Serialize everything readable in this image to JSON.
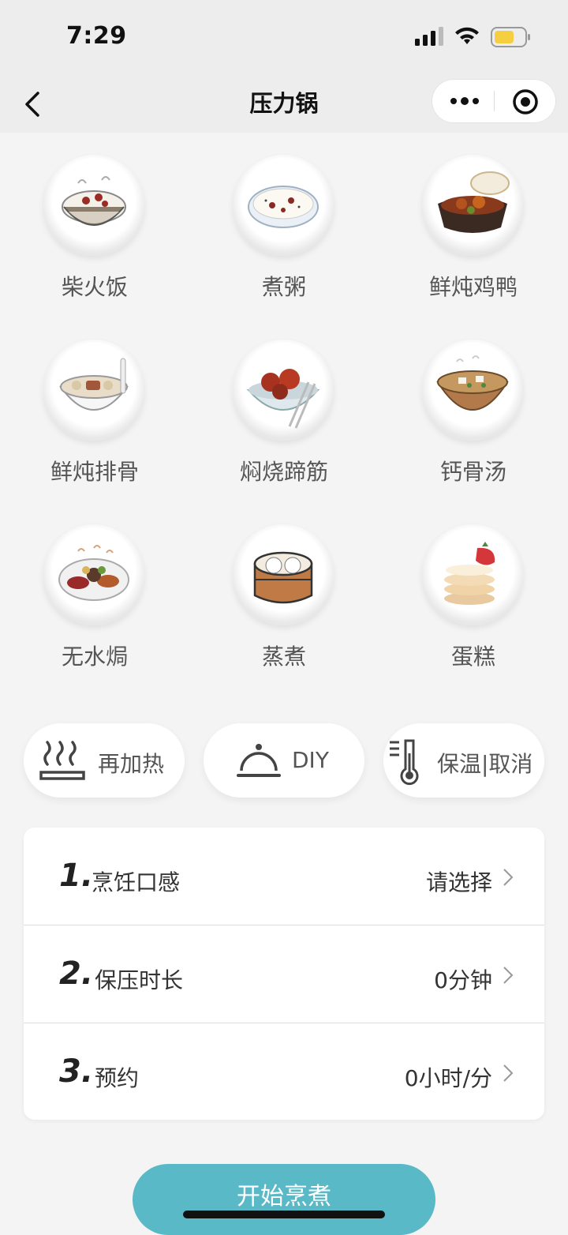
{
  "status": {
    "time": "7:29"
  },
  "nav": {
    "title": "压力锅"
  },
  "recipes": [
    {
      "label": "柴火饭",
      "icon": "rice-bowl-icon"
    },
    {
      "label": "煮粥",
      "icon": "porridge-icon"
    },
    {
      "label": "鲜炖鸡鸭",
      "icon": "clay-pot-chicken-icon"
    },
    {
      "label": "鲜炖排骨",
      "icon": "rib-soup-icon"
    },
    {
      "label": "焖烧蹄筋",
      "icon": "braised-tendon-icon"
    },
    {
      "label": "钙骨汤",
      "icon": "bone-soup-icon"
    },
    {
      "label": "无水焗",
      "icon": "waterless-bake-icon"
    },
    {
      "label": "蒸煮",
      "icon": "steamer-icon"
    },
    {
      "label": "蛋糕",
      "icon": "cake-icon"
    }
  ],
  "quick": {
    "reheat": "再加热",
    "diy": "DIY",
    "keep_warm": "保温|取消"
  },
  "settings": [
    {
      "num": "1.",
      "label": "烹饪口感",
      "value": "请选择"
    },
    {
      "num": "2.",
      "label": "保压时长",
      "value": "0分钟"
    },
    {
      "num": "3.",
      "label": "预约",
      "value": "0小时/分"
    }
  ],
  "start_button": "开始烹煮",
  "colors": {
    "accent": "#5ab9c6",
    "battery": "#f5cf3f"
  }
}
